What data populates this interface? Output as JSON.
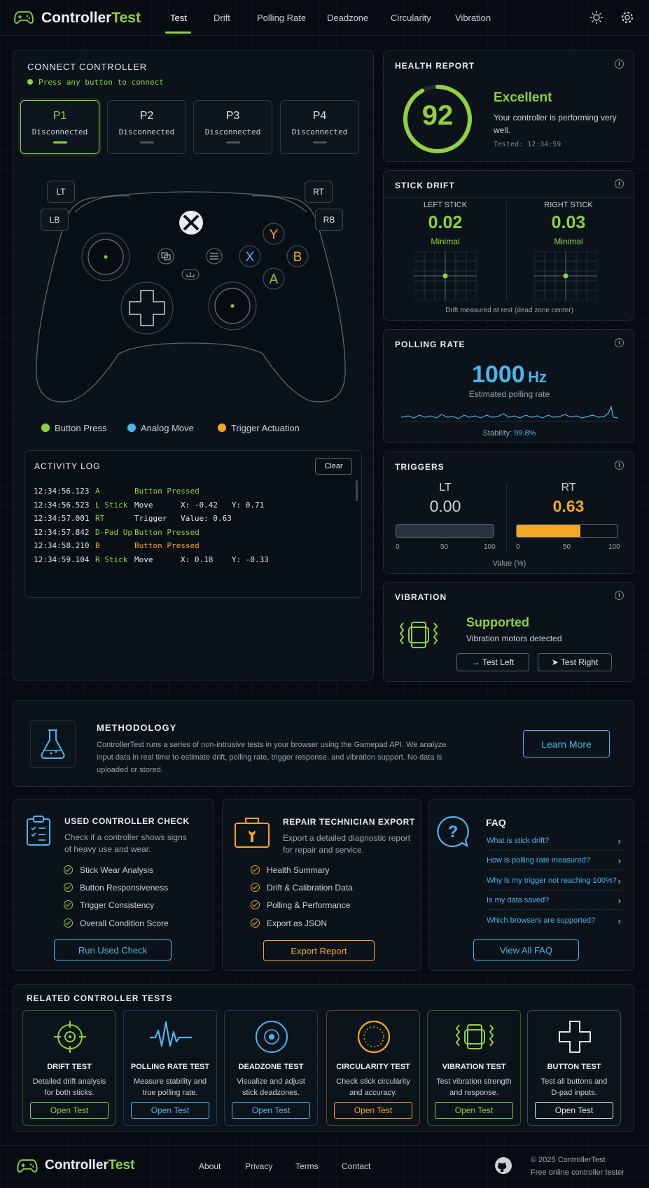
{
  "header": {
    "brand_a": "Controller",
    "brand_b": "Test",
    "nav": [
      "Test",
      "Drift",
      "Polling Rate",
      "Deadzone",
      "Circularity",
      "Vibration"
    ],
    "active_nav": "Test"
  },
  "connect": {
    "title": "CONNECT CONTROLLER",
    "status": "Press any button to connect",
    "players": [
      {
        "name": "P1",
        "status": "Disconnected"
      },
      {
        "name": "P2",
        "status": "Disconnected"
      },
      {
        "name": "P3",
        "status": "Disconnected"
      },
      {
        "name": "P4",
        "status": "Disconnected"
      }
    ]
  },
  "controller": {
    "shoulders": {
      "lt": "LT",
      "rt": "RT",
      "lb": "LB",
      "rb": "RB"
    },
    "face": {
      "y": "Y",
      "x": "X",
      "b": "B",
      "a": "A"
    },
    "colors": {
      "y": "#f5a623",
      "x": "#4cb6ec",
      "b": "#f5a623",
      "a": "#8fd13f"
    }
  },
  "legend": [
    {
      "label": "Button Press",
      "color": "#8fd13f"
    },
    {
      "label": "Analog Move",
      "color": "#4cb6ec"
    },
    {
      "label": "Trigger Actuation",
      "color": "#f5a623"
    }
  ],
  "log": {
    "title": "ACTIVITY LOG",
    "clear": "Clear",
    "rows": [
      {
        "time": "12:34:56.123",
        "input": "A",
        "text": "Button Pressed",
        "extra": ""
      },
      {
        "time": "12:34:56.523",
        "input": "L Stick",
        "text": "Move",
        "extra": "X: -0.42   Y: 0.71"
      },
      {
        "time": "12:34:57.001",
        "input": "RT",
        "text": "Trigger",
        "extra": "Value: 0.63"
      },
      {
        "time": "12:34:57.842",
        "input": "D-Pad Up",
        "text": "Button Pressed",
        "extra": ""
      },
      {
        "time": "12:34:58.210",
        "input": "B",
        "text": "Button Pressed",
        "extra": ""
      },
      {
        "time": "12:34:59.104",
        "input": "R Stick",
        "text": "Move",
        "extra": "X: 0.18    Y: -0.33"
      }
    ]
  },
  "health": {
    "title": "HEALTH REPORT",
    "score": "92",
    "score_value": 92,
    "rating": "Excellent",
    "desc": "Your controller is performing very well.",
    "tested": "Tested: 12:34:59"
  },
  "drift": {
    "title": "STICK DRIFT",
    "left": {
      "label": "LEFT STICK",
      "value": "0.02",
      "level": "Minimal"
    },
    "right": {
      "label": "RIGHT STICK",
      "value": "0.03",
      "level": "Minimal"
    },
    "note": "Drift measured at rest (dead zone center)"
  },
  "polling": {
    "title": "POLLING RATE",
    "value": "1000",
    "unit": "Hz",
    "sub": "Estimated polling rate",
    "stability_label": "Stability:",
    "stability": "99.8%"
  },
  "triggers": {
    "title": "TRIGGERS",
    "lt": {
      "label": "LT",
      "value": "0.00",
      "fill": 0.0
    },
    "rt": {
      "label": "RT",
      "value": "0.63",
      "fill": 0.63
    },
    "ticks": [
      "0",
      "50",
      "100"
    ],
    "axis": "Value (%)"
  },
  "vibration": {
    "title": "VIBRATION",
    "status": "Supported",
    "sub": "Vibration motors detected",
    "test_left": "Test Left",
    "test_right": "Test Right"
  },
  "methodology": {
    "title": "METHODOLOGY",
    "line1": "ControllerTest runs a series of non-intrusive tests in your browser using the Gamepad API. We analyze",
    "line2": "input data in real time to estimate drift, polling rate, trigger response, and vibration support. No data is",
    "line3": "uploaded or stored.",
    "button": "Learn More"
  },
  "used_check": {
    "title": "USED CONTROLLER CHECK",
    "desc1": "Check if a controller shows signs",
    "desc2": "of heavy use and wear.",
    "items": [
      "Stick Wear Analysis",
      "Button Responsiveness",
      "Trigger Consistency",
      "Overall Condition Score"
    ],
    "button": "Run Used Check"
  },
  "repair": {
    "title": "REPAIR TECHNICIAN EXPORT",
    "desc1": "Export a detailed diagnostic report",
    "desc2": "for repair and service.",
    "items": [
      "Health Summary",
      "Drift & Calibration Data",
      "Polling & Performance",
      "Export as JSON"
    ],
    "button": "Export Report"
  },
  "faq": {
    "title": "FAQ",
    "items": [
      "What is stick drift?",
      "How is polling rate measured?",
      "Why is my trigger not reaching 100%?",
      "Is my data saved?",
      "Which browsers are supported?"
    ],
    "button": "View All FAQ"
  },
  "related": {
    "title": "RELATED CONTROLLER TESTS",
    "cards": [
      {
        "title": "DRIFT TEST",
        "d1": "Detailed drift analysis",
        "d2": "for both sticks.",
        "button": "Open Test",
        "color": "#8fd13f"
      },
      {
        "title": "POLLING RATE TEST",
        "d1": "Measure stability and",
        "d2": "true polling rate.",
        "button": "Open Test",
        "color": "#4cb6ec"
      },
      {
        "title": "DEADZONE TEST",
        "d1": "Visualize and adjust",
        "d2": "stick deadzones.",
        "button": "Open Test",
        "color": "#4cb6ec"
      },
      {
        "title": "CIRCULARITY TEST",
        "d1": "Check stick circularity",
        "d2": "and accuracy.",
        "button": "Open Test",
        "color": "#f5a623"
      },
      {
        "title": "VIBRATION TEST",
        "d1": "Test vibration strength",
        "d2": "and response.",
        "button": "Open Test",
        "color": "#8fd13f"
      },
      {
        "title": "BUTTON TEST",
        "d1": "Test all buttons and",
        "d2": "D-pad inputs.",
        "button": "Open Test",
        "color": "#dfe6ee"
      }
    ]
  },
  "footer": {
    "brand_a": "Controller",
    "brand_b": "Test",
    "links": [
      "About",
      "Privacy",
      "Terms",
      "Contact"
    ],
    "copyright": "© 2025 ControllerTest",
    "tagline": "Free online controller tester"
  }
}
